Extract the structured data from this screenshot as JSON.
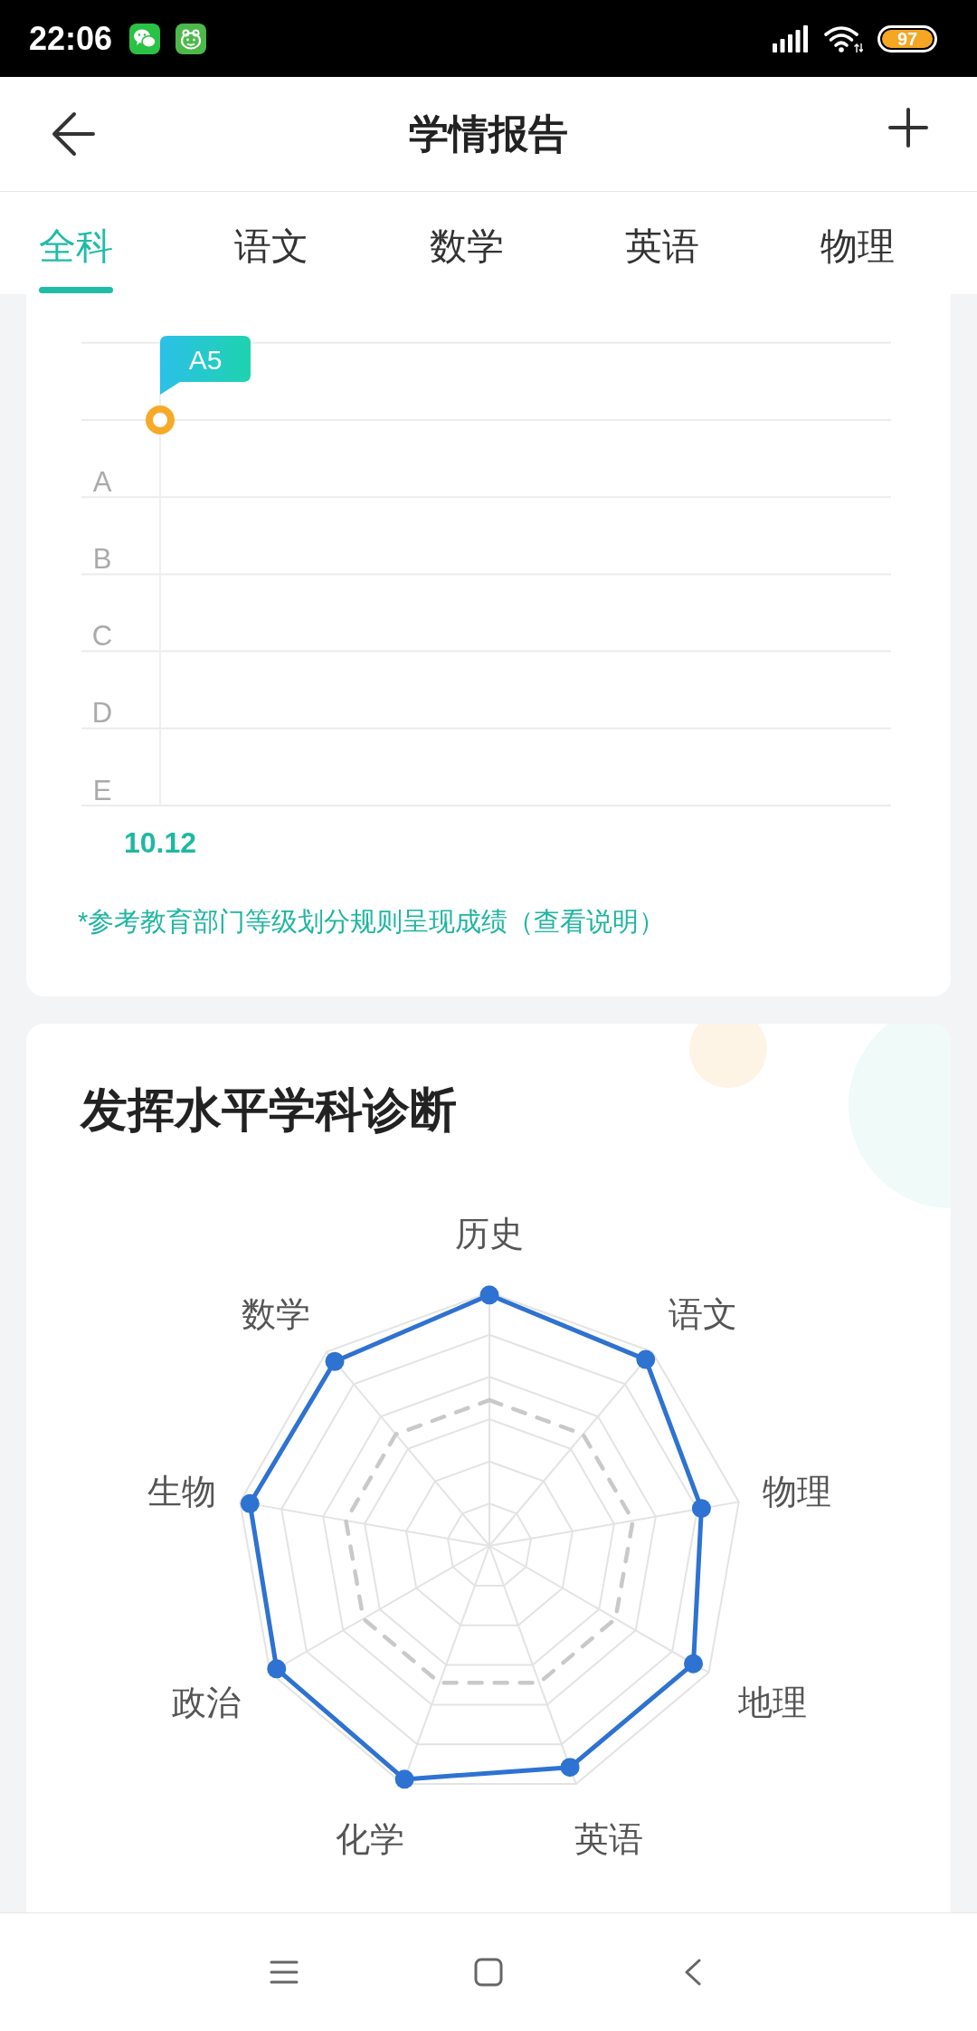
{
  "status_bar": {
    "time": "22:06",
    "battery": "97"
  },
  "header": {
    "title": "学情报告"
  },
  "tabs": [
    {
      "label": "全科",
      "selected": true
    },
    {
      "label": "语文",
      "selected": false
    },
    {
      "label": "数学",
      "selected": false
    },
    {
      "label": "英语",
      "selected": false
    },
    {
      "label": "物理",
      "selected": false
    }
  ],
  "grade_card": {
    "grade_chart": {
      "y_labels": [
        "A",
        "B",
        "C",
        "D",
        "E"
      ],
      "x_labels": [
        "10.12"
      ],
      "points": [
        {
          "label": "A5"
        }
      ]
    },
    "note": "*参考教育部门等级划分规则呈现成绩（查看说明）"
  },
  "diagnosis_card": {
    "title": "发挥水平学科诊断",
    "radar_axes": [
      "历史",
      "语文",
      "物理",
      "地理",
      "英语",
      "化学",
      "政治",
      "生物",
      "数学"
    ]
  }
}
